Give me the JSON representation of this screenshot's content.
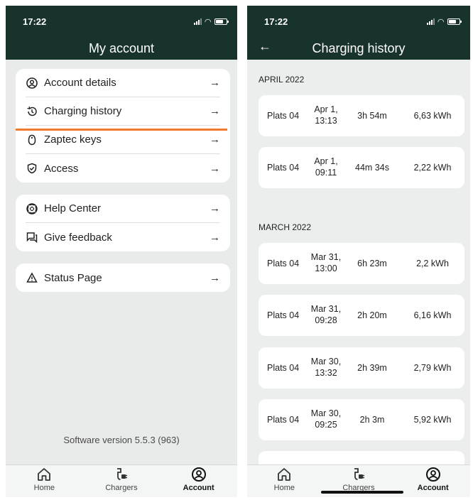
{
  "left": {
    "status_time": "17:22",
    "title": "My account",
    "groups": [
      [
        {
          "label": "Account details",
          "icon": "user-circle-icon"
        },
        {
          "label": "Charging history",
          "icon": "history-icon"
        },
        {
          "label": "Zaptec keys",
          "icon": "key-tag-icon"
        },
        {
          "label": "Access",
          "icon": "shield-check-icon"
        }
      ],
      [
        {
          "label": "Help Center",
          "icon": "lifebuoy-icon"
        },
        {
          "label": "Give feedback",
          "icon": "feedback-icon"
        }
      ],
      [
        {
          "label": "Status Page",
          "icon": "warning-icon"
        }
      ]
    ],
    "arrow": "→",
    "version": "Software version 5.5.3 (963)",
    "tabs": [
      {
        "label": "Home",
        "icon": "home-icon"
      },
      {
        "label": "Chargers",
        "icon": "charger-icon"
      },
      {
        "label": "Account",
        "icon": "account-icon"
      }
    ],
    "active_tab": "Account"
  },
  "right": {
    "status_time": "17:22",
    "title": "Charging history",
    "back": "←",
    "sections": [
      {
        "header": "APRIL 2022",
        "rows": [
          {
            "place": "Plats 04",
            "date": "Apr 1,",
            "time": "13:13",
            "duration": "3h 54m",
            "energy": "6,63 kWh"
          },
          {
            "place": "Plats 04",
            "date": "Apr 1,",
            "time": "09:11",
            "duration": "44m 34s",
            "energy": "2,22 kWh"
          }
        ]
      },
      {
        "header": "MARCH 2022",
        "rows": [
          {
            "place": "Plats 04",
            "date": "Mar 31,",
            "time": "13:00",
            "duration": "6h 23m",
            "energy": "2,2 kWh"
          },
          {
            "place": "Plats 04",
            "date": "Mar 31,",
            "time": "09:28",
            "duration": "2h 20m",
            "energy": "6,16 kWh"
          },
          {
            "place": "Plats 04",
            "date": "Mar 30,",
            "time": "13:32",
            "duration": "2h 39m",
            "energy": "2,79 kWh"
          },
          {
            "place": "Plats 04",
            "date": "Mar 30,",
            "time": "09:25",
            "duration": "2h 3m",
            "energy": "5,92 kWh"
          }
        ]
      }
    ],
    "tabs": [
      {
        "label": "Home",
        "icon": "home-icon"
      },
      {
        "label": "Chargers",
        "icon": "charger-icon"
      },
      {
        "label": "Account",
        "icon": "account-icon"
      }
    ],
    "active_tab": "Account"
  },
  "colors": {
    "header_bg": "#18322c",
    "highlight": "#ef7a2e"
  }
}
